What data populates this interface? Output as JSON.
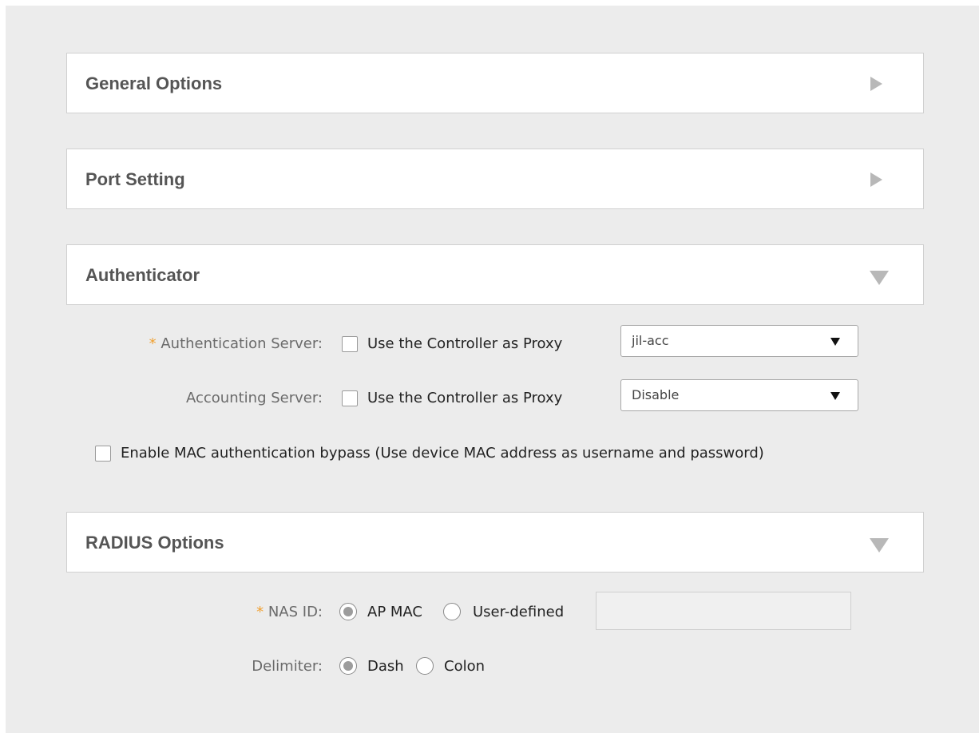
{
  "panels": {
    "general": {
      "title": "General Options",
      "state": "collapsed"
    },
    "port": {
      "title": "Port Setting",
      "state": "collapsed"
    },
    "authenticator": {
      "title": "Authenticator",
      "state": "expanded"
    },
    "radius": {
      "title": "RADIUS Options",
      "state": "expanded"
    }
  },
  "authenticator": {
    "auth_server": {
      "required_mark": "*",
      "label": "Authentication Server:",
      "proxy_label": "Use the Controller as Proxy",
      "proxy_checked": false,
      "selected": "jil-acc"
    },
    "accounting_server": {
      "label": "Accounting Server:",
      "proxy_label": "Use the Controller as Proxy",
      "proxy_checked": false,
      "selected": "Disable"
    },
    "mac_bypass": {
      "label": "Enable MAC authentication bypass (Use device MAC address as username and password)",
      "checked": false
    }
  },
  "radius": {
    "nas_id": {
      "required_mark": "*",
      "label": "NAS ID:",
      "options": [
        "AP MAC",
        "User-defined"
      ],
      "selected": "AP MAC",
      "user_defined_value": ""
    },
    "delimiter": {
      "label": "Delimiter:",
      "options": [
        "Dash",
        "Colon"
      ],
      "selected": "Dash"
    }
  },
  "icons": {
    "collapsed": "triangle-right-icon",
    "expanded": "triangle-down-icon",
    "dropdown": "caret-down-icon"
  }
}
